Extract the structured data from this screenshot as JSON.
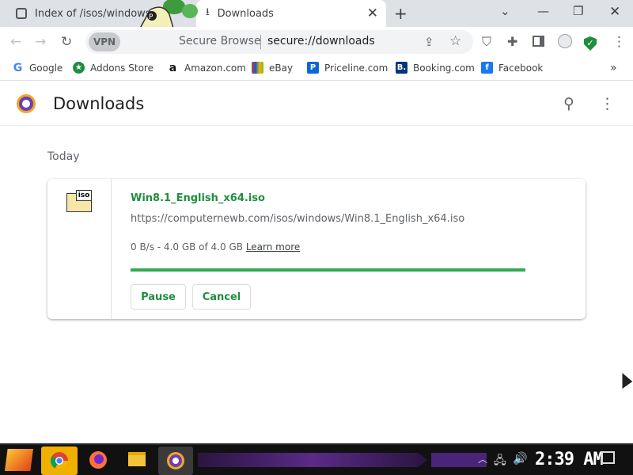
{
  "tabs": [
    {
      "label": "Index of /isos/windows/"
    },
    {
      "label": "Downloads"
    }
  ],
  "toolbar": {
    "vpn_label": "VPN",
    "secure_label": "Secure Browse",
    "url": "secure://downloads"
  },
  "bookmarks": [
    {
      "label": "Google",
      "icon": "google-icon"
    },
    {
      "label": "Addons Store",
      "icon": "addons-store-icon"
    },
    {
      "label": "Amazon.com",
      "icon": "amazon-icon"
    },
    {
      "label": "eBay",
      "icon": "ebay-icon"
    },
    {
      "label": "Priceline.com",
      "icon": "priceline-icon"
    },
    {
      "label": "Booking.com",
      "icon": "booking-icon"
    },
    {
      "label": "Facebook",
      "icon": "facebook-icon"
    }
  ],
  "page": {
    "title": "Downloads",
    "section": "Today"
  },
  "download": {
    "file_name": "Win8.1_English_x64.iso",
    "file_icon_label": "iso",
    "url": "https://computernewb.com/isos/windows/Win8.1_English_x64.iso",
    "status": "0 B/s - 4.0 GB of 4.0 GB",
    "learn_more": "Learn more",
    "progress": 1.0,
    "pause_label": "Pause",
    "cancel_label": "Cancel"
  },
  "taskbar": {
    "clock": "2:39 AM"
  },
  "colors": {
    "accent_green": "#1e8e3e",
    "progress_green": "#34a853",
    "tabstrip": "#dee1e6"
  }
}
